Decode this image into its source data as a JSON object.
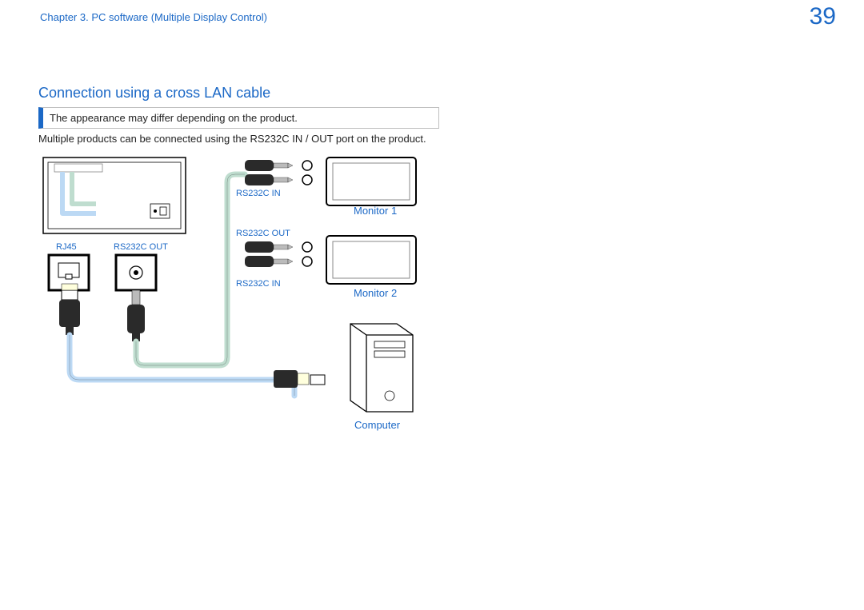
{
  "header": {
    "chapter": "Chapter 3. PC software (Multiple Display Control)",
    "page_number": "39"
  },
  "section": {
    "title": "Connection using a cross LAN cable",
    "note": "The appearance may differ depending on the product.",
    "description": "Multiple products can be connected using the RS232C IN / OUT port on the product."
  },
  "diagram": {
    "colors": {
      "text_accent": "#1b68c6",
      "wire_lan": "#bcd9f4",
      "wire_signal": "#bfddcf",
      "outline": "#000000"
    },
    "port_labels": {
      "rj45": "RJ45",
      "left_rs232c_out": "RS232C OUT",
      "rs232c_in_top": "RS232C IN",
      "rs232c_out_mid": "RS232C OUT",
      "rs232c_in_bottom": "RS232C IN"
    },
    "devices": {
      "monitor1": "Monitor 1",
      "monitor2": "Monitor 2",
      "computer": "Computer"
    },
    "icons": [
      "device-back-panel",
      "rj45-port",
      "rs232c-port",
      "audio-jack-plug",
      "monitor",
      "computer-tower",
      "lan-cable",
      "rs232c-cable"
    ]
  }
}
